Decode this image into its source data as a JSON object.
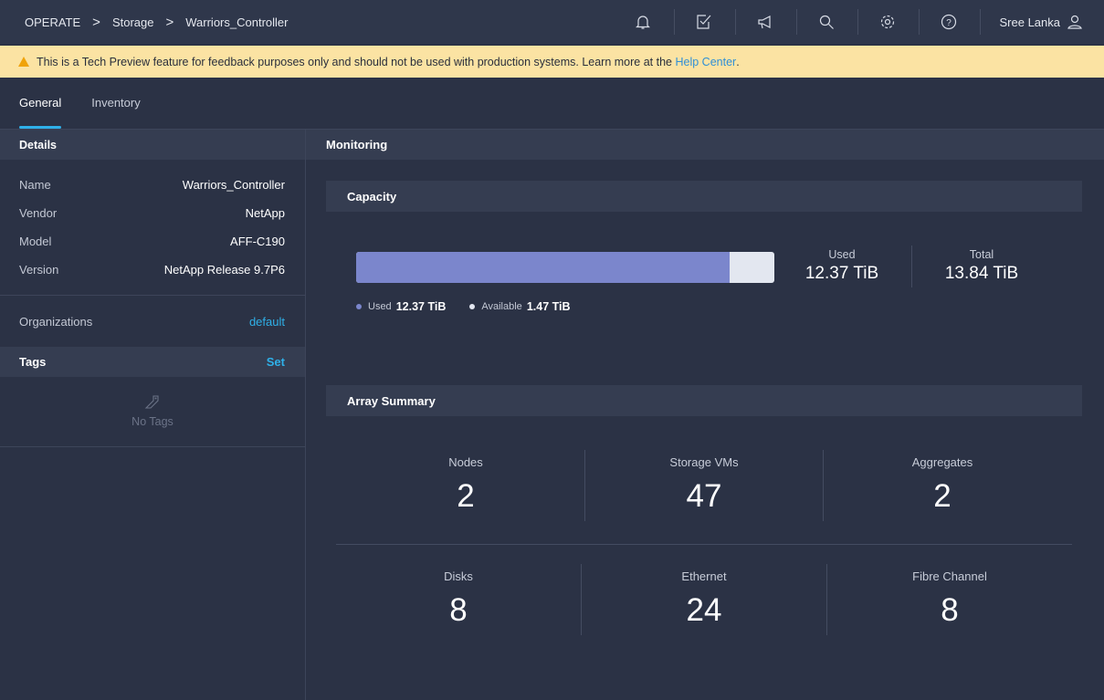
{
  "breadcrumb": {
    "items": [
      "OPERATE",
      "Storage",
      "Warriors_Controller"
    ],
    "separator": ">"
  },
  "topbar": {
    "icons": [
      "bell-icon",
      "checklist-icon",
      "megaphone-icon",
      "search-icon",
      "gear-icon",
      "help-icon"
    ],
    "user_name": "Sree Lanka"
  },
  "banner": {
    "text": "This is a Tech Preview feature for feedback purposes only and should not be used with production systems. Learn more at the",
    "link": "Help Center",
    "end": "."
  },
  "tabs": [
    {
      "label": "General",
      "active": true
    },
    {
      "label": "Inventory",
      "active": false
    }
  ],
  "details": {
    "title": "Details",
    "rows": [
      {
        "key": "Name",
        "value": "Warriors_Controller"
      },
      {
        "key": "Vendor",
        "value": "NetApp"
      },
      {
        "key": "Model",
        "value": "AFF-C190"
      },
      {
        "key": "Version",
        "value": "NetApp Release 9.7P6"
      }
    ],
    "organizations_label": "Organizations",
    "organizations_value": "default",
    "tags_label": "Tags",
    "tags_action": "Set",
    "no_tags": "No Tags"
  },
  "monitoring": {
    "title": "Monitoring",
    "capacity": {
      "title": "Capacity",
      "used_fraction": 0.894,
      "used_label": "Used",
      "used_value": "12.37 TiB",
      "total_label": "Total",
      "total_value": "13.84 TiB",
      "legend_used_label": "Used",
      "legend_used_value": "12.37 TiB",
      "legend_available_label": "Available",
      "legend_available_value": "1.47 TiB",
      "used_color": "#7b86cc",
      "available_color": "#e3e7f0"
    },
    "array_summary": {
      "title": "Array Summary",
      "nodes_label": "Nodes",
      "nodes_value": "2",
      "svms_label": "Storage VMs",
      "svms_value": "47",
      "aggregates_label": "Aggregates",
      "aggregates_value": "2",
      "disks_label": "Disks",
      "disks_value": "8",
      "ethernet_label": "Ethernet",
      "ethernet_value": "24",
      "fc_label": "Fibre Channel",
      "fc_value": "8"
    }
  },
  "colors": {
    "accent": "#2fb0e8",
    "banner_bg": "#fbe3a3",
    "warning": "#f0a30a"
  }
}
